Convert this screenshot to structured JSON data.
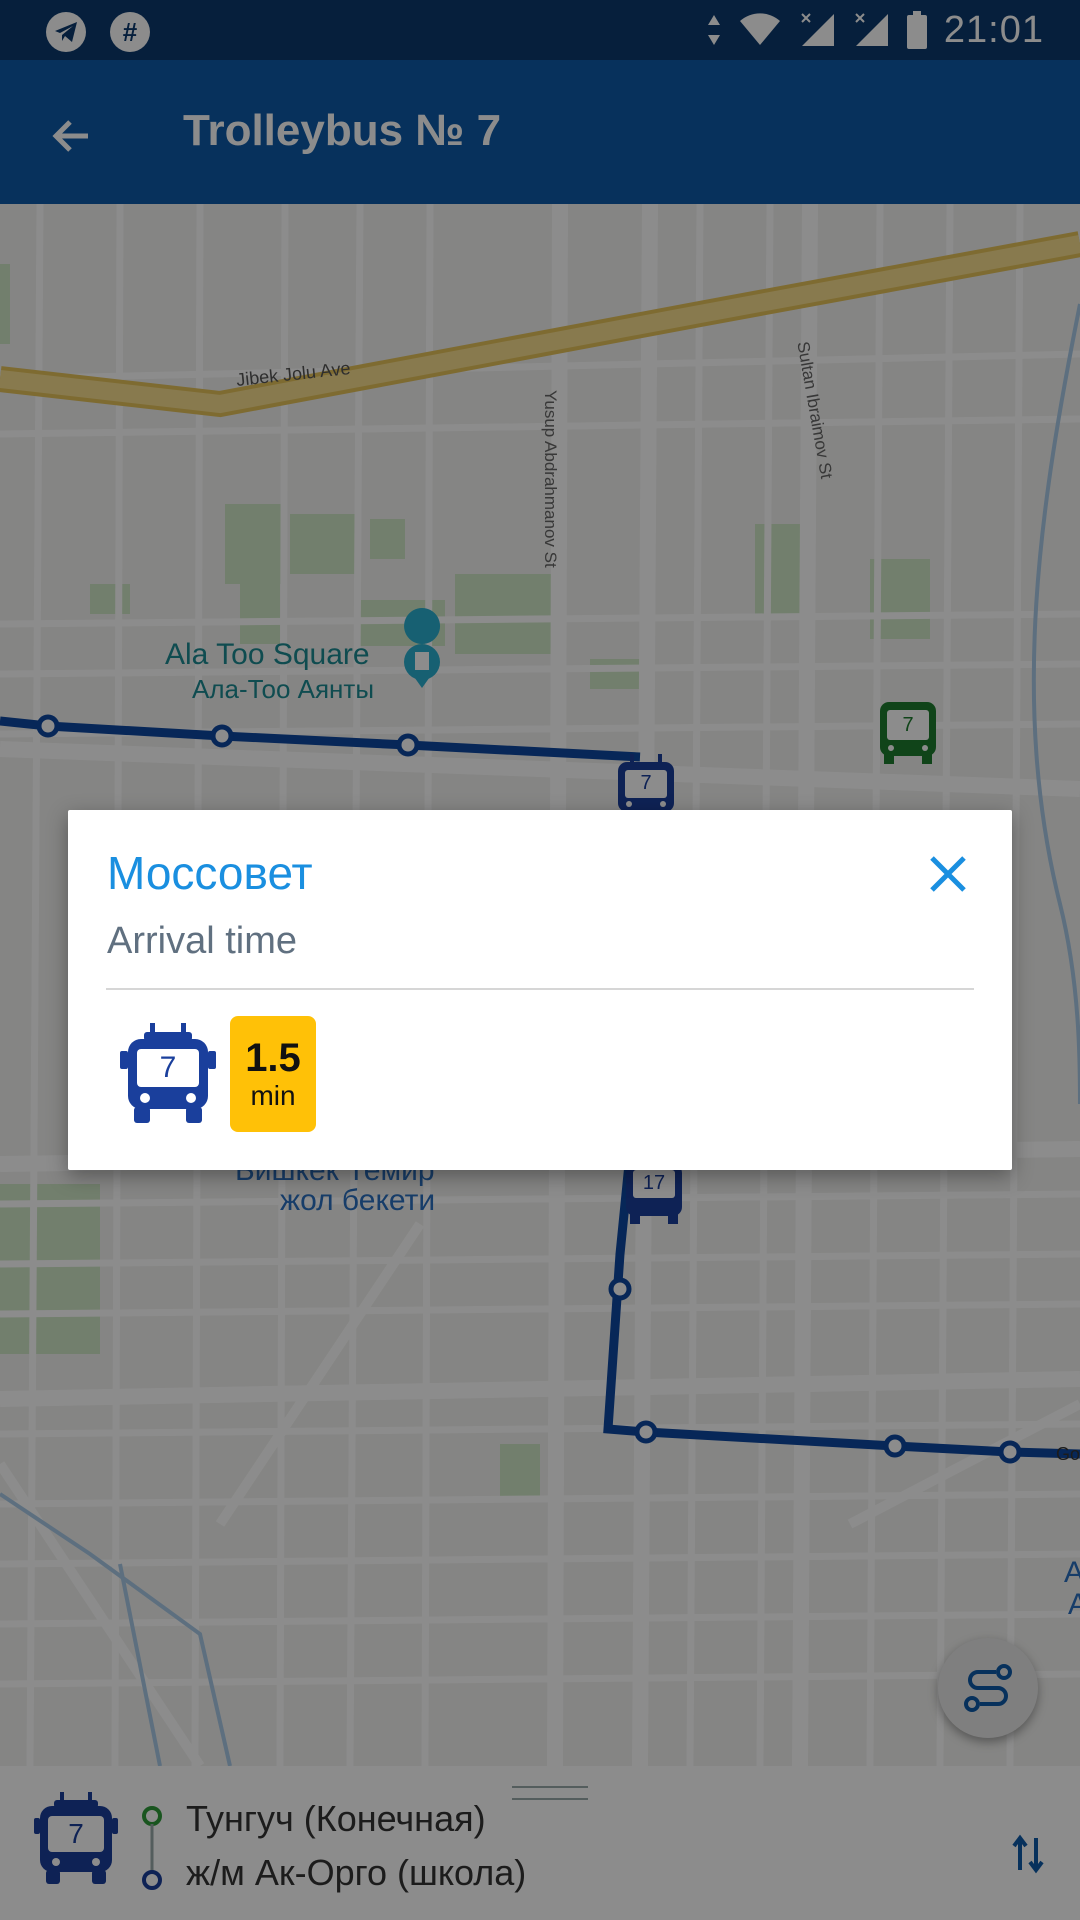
{
  "status_bar": {
    "time": "21:01",
    "left_icons": [
      "telegram-icon",
      "hashtag-icon"
    ],
    "right_icons": [
      "data-arrows-icon",
      "wifi-icon",
      "signal-icon",
      "signal-icon",
      "battery-icon"
    ]
  },
  "app_bar": {
    "title": "Trolleybus № 7",
    "back_icon": "arrow-left-icon"
  },
  "map": {
    "labels": {
      "jibek_jolu": "Jibek Jolu Ave",
      "yusup": "Yusup Abdrahmanov St",
      "sultan": "Sultan Ibraimov St",
      "ala_too_en": "Ala Too Square",
      "ala_too_ru": "Ала-Тоо Аянты",
      "station_top": "Бишкек Темир",
      "station_bottom": "жол бекети",
      "edge_label_go": "Go",
      "edge_label_a1": "A",
      "edge_label_a2": "A"
    },
    "vehicles": [
      {
        "route": "7",
        "color": "#1a3f9c"
      },
      {
        "route": "7",
        "color": "#1e7d2e"
      },
      {
        "route": "17",
        "color": "#1a3f9c"
      }
    ],
    "colors": {
      "route_line": "#0d47a1",
      "main_road": "#f2d37a"
    }
  },
  "dialog": {
    "title": "Моссовет",
    "subtitle": "Arrival time",
    "close_icon": "close-icon",
    "arrivals": [
      {
        "route": "7",
        "eta_value": "1.5",
        "eta_unit": "min"
      }
    ]
  },
  "fab": {
    "icon": "route-icon"
  },
  "bottom_sheet": {
    "route": "7",
    "from_stop": "Тунгуч (Конечная)",
    "to_stop": "ж/м Ак-Орго (школа)",
    "swap_icon": "swap-direction-icon"
  },
  "theme": {
    "status_bar": "#0b3a6e",
    "app_bar": "#0d5aa8",
    "accent": "#1a8fe0",
    "eta_badge": "#ffc107"
  }
}
